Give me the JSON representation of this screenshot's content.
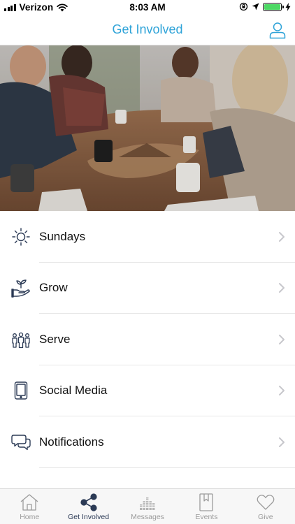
{
  "status_bar": {
    "carrier": "Verizon",
    "time": "8:03 AM",
    "battery_percent": 100,
    "signal_bars": 4
  },
  "nav": {
    "title": "Get Involved",
    "profile_icon": "person-outline-icon"
  },
  "hero": {
    "image_description_icon": "group-meeting-photo"
  },
  "menu": {
    "items": [
      {
        "label": "Sundays",
        "icon": "sun-icon"
      },
      {
        "label": "Grow",
        "icon": "hand-sprout-icon"
      },
      {
        "label": "Serve",
        "icon": "people-group-icon"
      },
      {
        "label": "Social Media",
        "icon": "tablet-icon"
      },
      {
        "label": "Notifications",
        "icon": "chat-bubbles-icon"
      }
    ]
  },
  "tab_bar": {
    "active_tab": "Get Involved",
    "tabs": [
      {
        "label": "Home",
        "icon": "house-icon"
      },
      {
        "label": "Get Involved",
        "icon": "share-icon"
      },
      {
        "label": "Messages",
        "icon": "equalizer-icon"
      },
      {
        "label": "Events",
        "icon": "bookmark-book-icon"
      },
      {
        "label": "Give",
        "icon": "heart-icon"
      }
    ]
  },
  "colors": {
    "accent": "#2ea3d8",
    "icon_navy": "#2b3a55",
    "tab_inactive": "#9b9b9b",
    "battery": "#4cd964"
  }
}
